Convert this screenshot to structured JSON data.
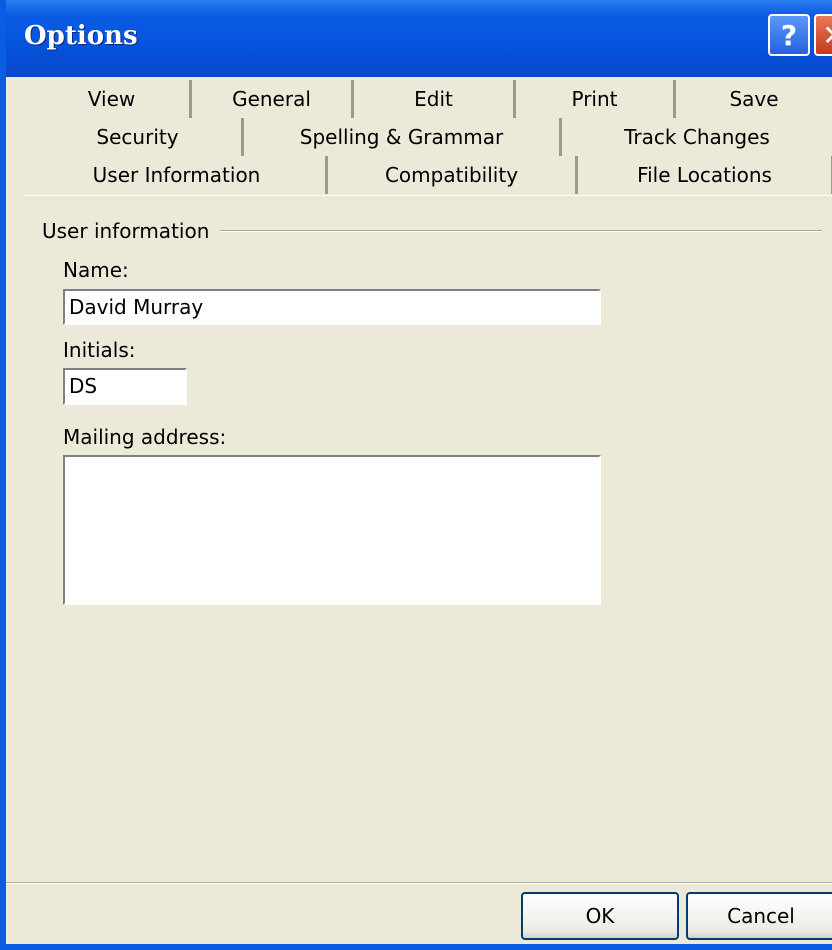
{
  "window": {
    "title": "Options",
    "help_label": "?",
    "close_label": "✕"
  },
  "tabs": {
    "row1": [
      "View",
      "General",
      "Edit",
      "Print",
      "Save"
    ],
    "row2": [
      "Security",
      "Spelling & Grammar",
      "Track Changes"
    ],
    "row3": [
      "User Information",
      "Compatibility",
      "File Locations"
    ],
    "active": "User Information"
  },
  "user_info": {
    "group_label": "User information",
    "name_label": "Name:",
    "name_value": "David Murray",
    "initials_label": "Initials:",
    "initials_value": "DS",
    "address_label": "Mailing address:",
    "address_value": ""
  },
  "buttons": {
    "ok": "OK",
    "cancel": "Cancel"
  }
}
